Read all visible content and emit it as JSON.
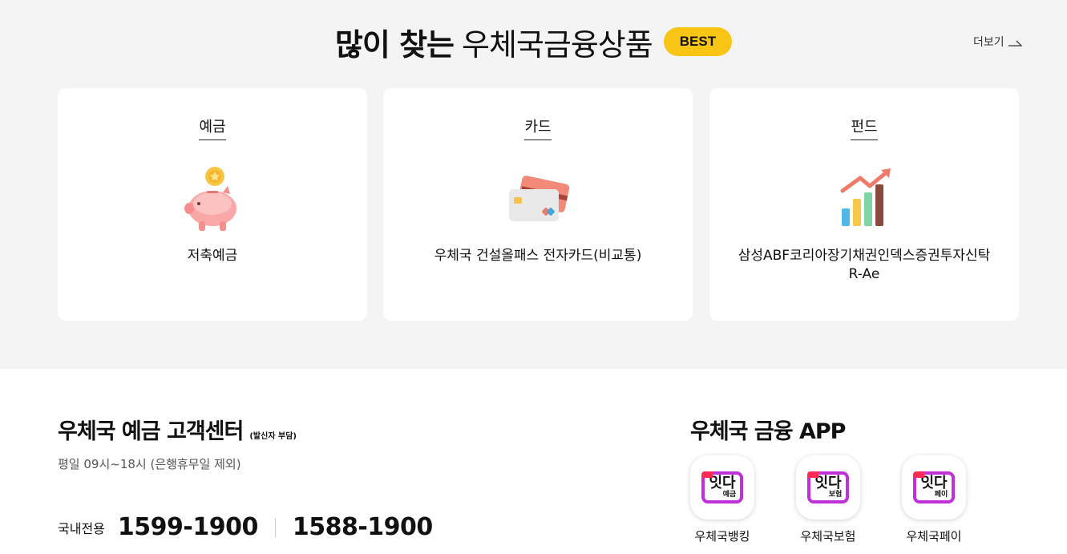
{
  "best": {
    "title_bold": "많이 찾는",
    "title_light": "우체국금융상품",
    "badge": "BEST",
    "more_label": "더보기",
    "cards": [
      {
        "category": "예금",
        "name": "저축예금",
        "icon": "piggy-bank-icon"
      },
      {
        "category": "카드",
        "name": "우체국 건설올패스 전자카드(비교통)",
        "icon": "credit-card-icon"
      },
      {
        "category": "펀드",
        "name": "삼성ABF코리아장기채권인덱스증권투자신탁 R-Ae",
        "icon": "growth-chart-icon"
      }
    ]
  },
  "customer_center": {
    "title": "우체국 예금 고객센터",
    "title_note": "(발신자 부담)",
    "hours": "평일 09시~18시 (은행휴무일 제외)",
    "domestic_label": "국내전용",
    "phones": [
      "1599-1900",
      "1588-1900"
    ]
  },
  "apps": {
    "title": "우체국 금융 APP",
    "items": [
      {
        "badge_big": "잇다",
        "badge_small": "예금",
        "name": "우체국뱅킹"
      },
      {
        "badge_big": "잇다",
        "badge_small": "보험",
        "name": "우체국보험"
      },
      {
        "badge_big": "잇다",
        "badge_small": "페이",
        "name": "우체국페이"
      }
    ]
  },
  "colors": {
    "accent_yellow": "#f8c514",
    "section_bg": "#f4f4f4",
    "app_frame": "#c030d8"
  }
}
